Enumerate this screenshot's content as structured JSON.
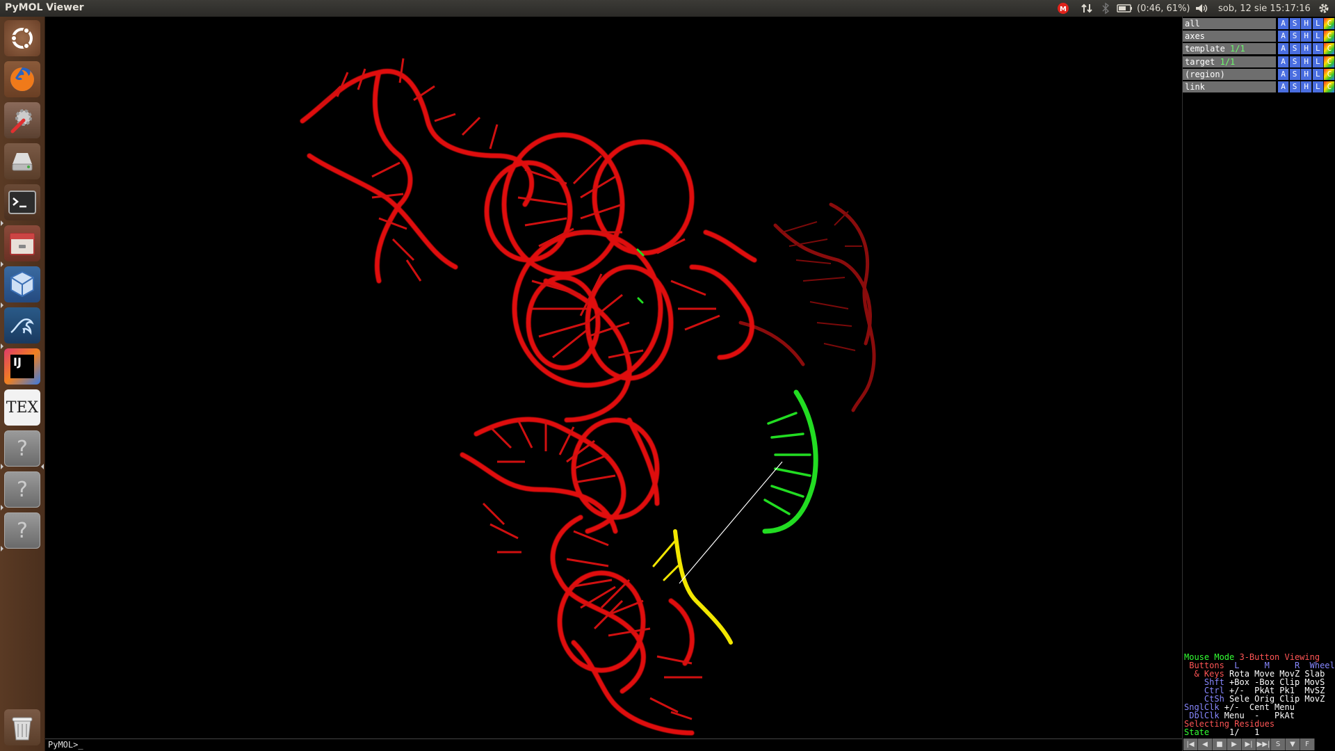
{
  "topbar": {
    "app_title": "PyMOL Viewer",
    "battery": "(0:46, 61%)",
    "datetime": "sob, 12 sie 15:17:16",
    "icons": [
      "mail-indicator-icon",
      "network-arrows-icon",
      "bluetooth-icon",
      "battery-icon",
      "volume-icon",
      "gear-icon"
    ]
  },
  "launcher": {
    "items": [
      "ubuntu-dash-icon",
      "firefox-icon",
      "system-settings-icon",
      "disk-drive-icon",
      "terminal-icon",
      "file-archive-icon",
      "virtualbox-icon",
      "mysql-workbench-icon",
      "intellij-icon",
      "texmaker-icon",
      "unknown-app-icon",
      "unknown-app-icon",
      "unknown-app-icon",
      "trash-icon"
    ],
    "tex_label": "TEX",
    "ij_label": "IJ",
    "unknown_glyph": "?"
  },
  "objects": [
    {
      "name": "all",
      "state": ""
    },
    {
      "name": "axes",
      "state": ""
    },
    {
      "name": "template",
      "state": "1/1"
    },
    {
      "name": "target",
      "state": "1/1"
    },
    {
      "name": "(region)",
      "state": ""
    },
    {
      "name": "link",
      "state": ""
    }
  ],
  "object_buttons": [
    "A",
    "S",
    "H",
    "L",
    "C"
  ],
  "mouse_panel": {
    "l1a": "Mouse Mode ",
    "l1b": "3-Button Viewing",
    "l2a": " Buttons  ",
    "l2b": "L     M     R  Wheel",
    "l3a": "  & Keys ",
    "l3b": "Rota Move MovZ Slab",
    "l4a": "    Shft ",
    "l4b": "+Box -Box Clip MovS",
    "l5a": "    Ctrl ",
    "l5b": "+/-  PkAt Pk1  MvSZ",
    "l6a": "    CtSh ",
    "l6b": "Sele Orig Clip MovZ",
    "l7a": "SnglClk ",
    "l7b": "+/-  Cent Menu",
    "l8a": " DblClk ",
    "l8b": "Menu  -   PkAt",
    "l9": "Selecting Residues",
    "l10a": "State ",
    "l10b": "   1/   1"
  },
  "vcr_buttons": [
    "|◀",
    "◀",
    "■",
    "▶",
    "▶|",
    "▶▶|",
    "S",
    "▼",
    "F"
  ],
  "command_prompt": "PyMOL>_",
  "colors": {
    "template": "#ff1a1a",
    "target": "#22dd22",
    "region": "#ffee00",
    "link": "#ffffff"
  }
}
